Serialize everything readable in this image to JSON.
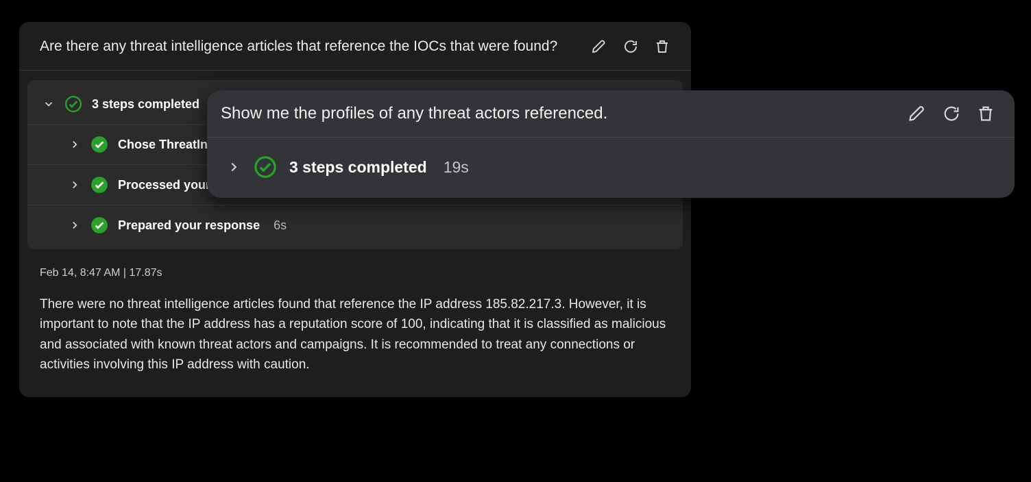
{
  "card1": {
    "prompt": "Are there any threat intelligence articles that reference the IOCs that were found?",
    "summary": {
      "label": "3 steps completed"
    },
    "steps": [
      {
        "label": "Chose ThreatIntelligence.FindThreatIntelligence",
        "time": ""
      },
      {
        "label": "Processed your request",
        "time": ""
      },
      {
        "label": "Prepared your response",
        "time": "6s"
      }
    ],
    "meta": "Feb 14, 8:47 AM  |  17.87s",
    "body": "There were no threat intelligence articles found that reference the IP address 185.82.217.3. However, it is important to note that the IP address has a reputation score of 100, indicating that it is classified as malicious and associated with known threat actors and campaigns. It is recommended to treat any connections or activities involving this IP address with caution."
  },
  "card2": {
    "prompt": "Show me the profiles of any threat actors referenced.",
    "summary": {
      "label": "3 steps completed",
      "time": "19s"
    }
  }
}
